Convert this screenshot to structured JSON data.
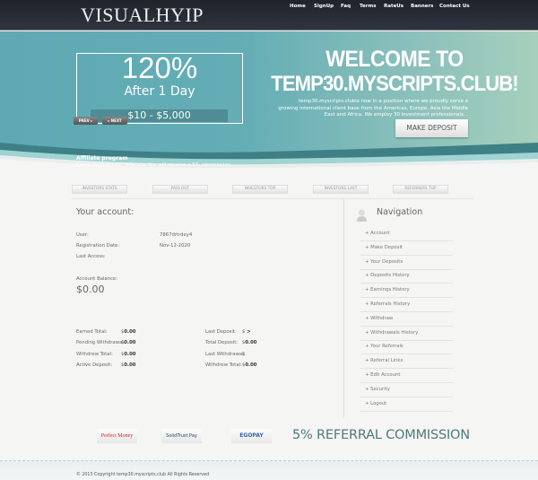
{
  "header": {
    "logo": "VISUALHYIP",
    "nav": [
      "Home",
      "SignUp",
      "Faq",
      "Terms",
      "RateUs",
      "Banners",
      "Contact Us"
    ]
  },
  "banner": {
    "percent": "120%",
    "after": "After 1 Day",
    "range": "$10 - $5,000",
    "prev": "PREV",
    "next": "NEXT",
    "affiliate_title": "Affiliate program",
    "affiliate_text": "Every deposit your referrals. You will receive a 5% commission",
    "welcome1": "WELCOME TO",
    "welcome2": "TEMP30.MYSCRIPTS.CLUB!",
    "description": "temp30.myscripts.clubis now in a position where we proudly serve a growing international client base from the Americas, Europe, Asia the Middle East and Africa. We employ 30 investment professionals. .",
    "make_deposit": "MAKE DEPOSIT",
    "colors": {
      "left": "#5ea9b4",
      "right": "#a6d0bc"
    }
  },
  "tabs": [
    "INVESTORS STATS",
    "PAID OUT",
    "INVESTORS TOP",
    "INVESTORS LAST",
    "REFERRERS TOP"
  ],
  "account": {
    "title": "Your account:",
    "user_label": "User:",
    "user": "7867drtrdey4",
    "reg_label": "Registration Date:",
    "reg": "Nov-12-2020",
    "last_access_label": "Last Access:",
    "balance_label": "Account Balance:",
    "balance": "$0.00",
    "stats_left": [
      {
        "label": "Earned Total:",
        "cur": "$",
        "val": "0.00"
      },
      {
        "label": "Pending Withdrawal:",
        "cur": "$",
        "val": "0.00"
      },
      {
        "label": "Withdrew Total:",
        "cur": "$",
        "val": "0.00"
      },
      {
        "label": "Active Deposit:",
        "cur": "$",
        "val": "0.00"
      }
    ],
    "stats_right": [
      {
        "label": "Last Deposit:",
        "cur": "$",
        "val": " >"
      },
      {
        "label": "Total Deposit:",
        "cur": "$",
        "val": "0.00"
      },
      {
        "label": "Last Withdrawal:",
        "cur": "$",
        "val": ""
      },
      {
        "label": "Withdrew Total:",
        "cur": "$",
        "val": "0.00"
      }
    ]
  },
  "navigation": {
    "title": "Navigation",
    "items": [
      "Account",
      "Make Deposit",
      "Your Deposits",
      "Deposits History",
      "Earnings History",
      "Referrals History",
      "Withdraw",
      "Withdrawals History",
      "Your Referrals",
      "Referral Links",
      "Edit Account",
      "Security",
      "Logout"
    ]
  },
  "payments": {
    "logos": [
      "Perfect Money",
      "SolidTrust Pay",
      "EGOPAY"
    ],
    "referral": "5% REFERRAL COMMISSION"
  },
  "footer": {
    "copyright": "© 2013 Copyright temp30.myscripts.club All Rights Reserved"
  }
}
